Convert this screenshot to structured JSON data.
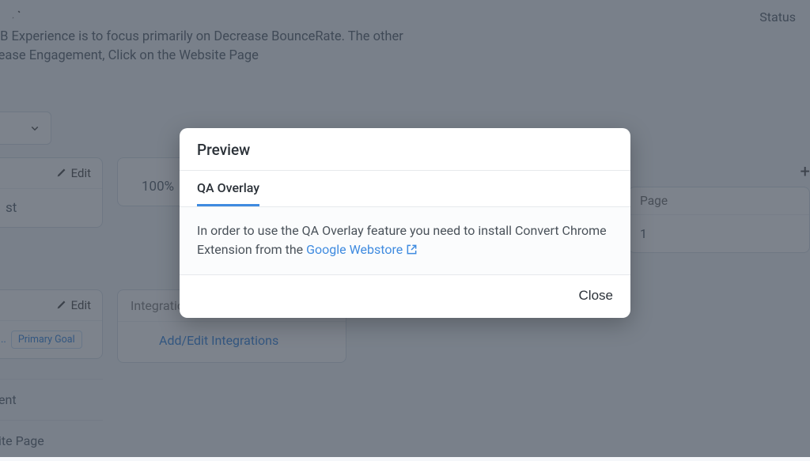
{
  "background": {
    "status_label": "Status",
    "description_line1": "s A/B Experience is to focus primarily on Decrease BounceRate. The other",
    "description_line2": " Increase Engagement, Click on the Website Page",
    "edit_label": "Edit",
    "percent_value": "100%",
    "st_text": "st",
    "page_label": "Page",
    "num_1": "1",
    "integrations_label": "Integrations",
    "add_edit_integrations": "Add/Edit Integrations",
    "primary_goal": "Primary Goal",
    "badge_dots": "..",
    "list_item_1": "ent",
    "list_item_2": "ite Page"
  },
  "modal": {
    "title": "Preview",
    "tab_label": "QA Overlay",
    "body_text_before": "In order to use the QA Overlay feature you need to install Convert Chrome Extension from the ",
    "link_text": "Google Webstore",
    "close_label": "Close"
  }
}
